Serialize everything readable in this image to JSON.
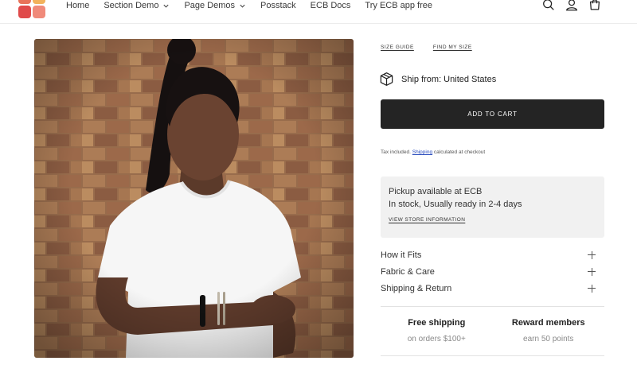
{
  "header": {
    "nav": [
      {
        "label": "Home",
        "has_dropdown": false
      },
      {
        "label": "Section Demo",
        "has_dropdown": true
      },
      {
        "label": "Page Demos",
        "has_dropdown": true
      },
      {
        "label": "Posstack",
        "has_dropdown": false
      },
      {
        "label": "ECB Docs",
        "has_dropdown": false
      },
      {
        "label": "Try ECB app free",
        "has_dropdown": false
      }
    ],
    "icons": [
      "search-icon",
      "account-icon",
      "cart-icon"
    ],
    "logo_colors": [
      "#e8735a",
      "#f2b25c",
      "#e04b4b",
      "#f08a7a"
    ]
  },
  "product": {
    "image_alt": "Woman wearing white t-shirt in front of brick wall"
  },
  "size_links": {
    "size_guide": "SIZE GUIDE",
    "find_my_size": "FIND MY SIZE"
  },
  "shipping": {
    "ship_from": "Ship from: United States"
  },
  "cart": {
    "add_to_cart": "ADD TO CART"
  },
  "tax": {
    "prefix": "Tax included.",
    "link": "Shipping",
    "suffix": "calculated at checkout"
  },
  "pickup": {
    "line1": "Pickup available at ECB",
    "line2": "In stock, Usually ready in 2-4 days",
    "store_link": "VIEW STORE INFORMATION"
  },
  "accordion": [
    {
      "label": "How it Fits"
    },
    {
      "label": "Fabric & Care"
    },
    {
      "label": "Shipping & Return"
    }
  ],
  "perks": [
    {
      "title": "Free shipping",
      "subtitle": "on orders $100+"
    },
    {
      "title": "Reward members",
      "subtitle": "earn 50 points"
    }
  ],
  "colors": {
    "primary_button": "#242424",
    "pickup_bg": "#f1f1f1",
    "link": "#2b4dbd"
  }
}
